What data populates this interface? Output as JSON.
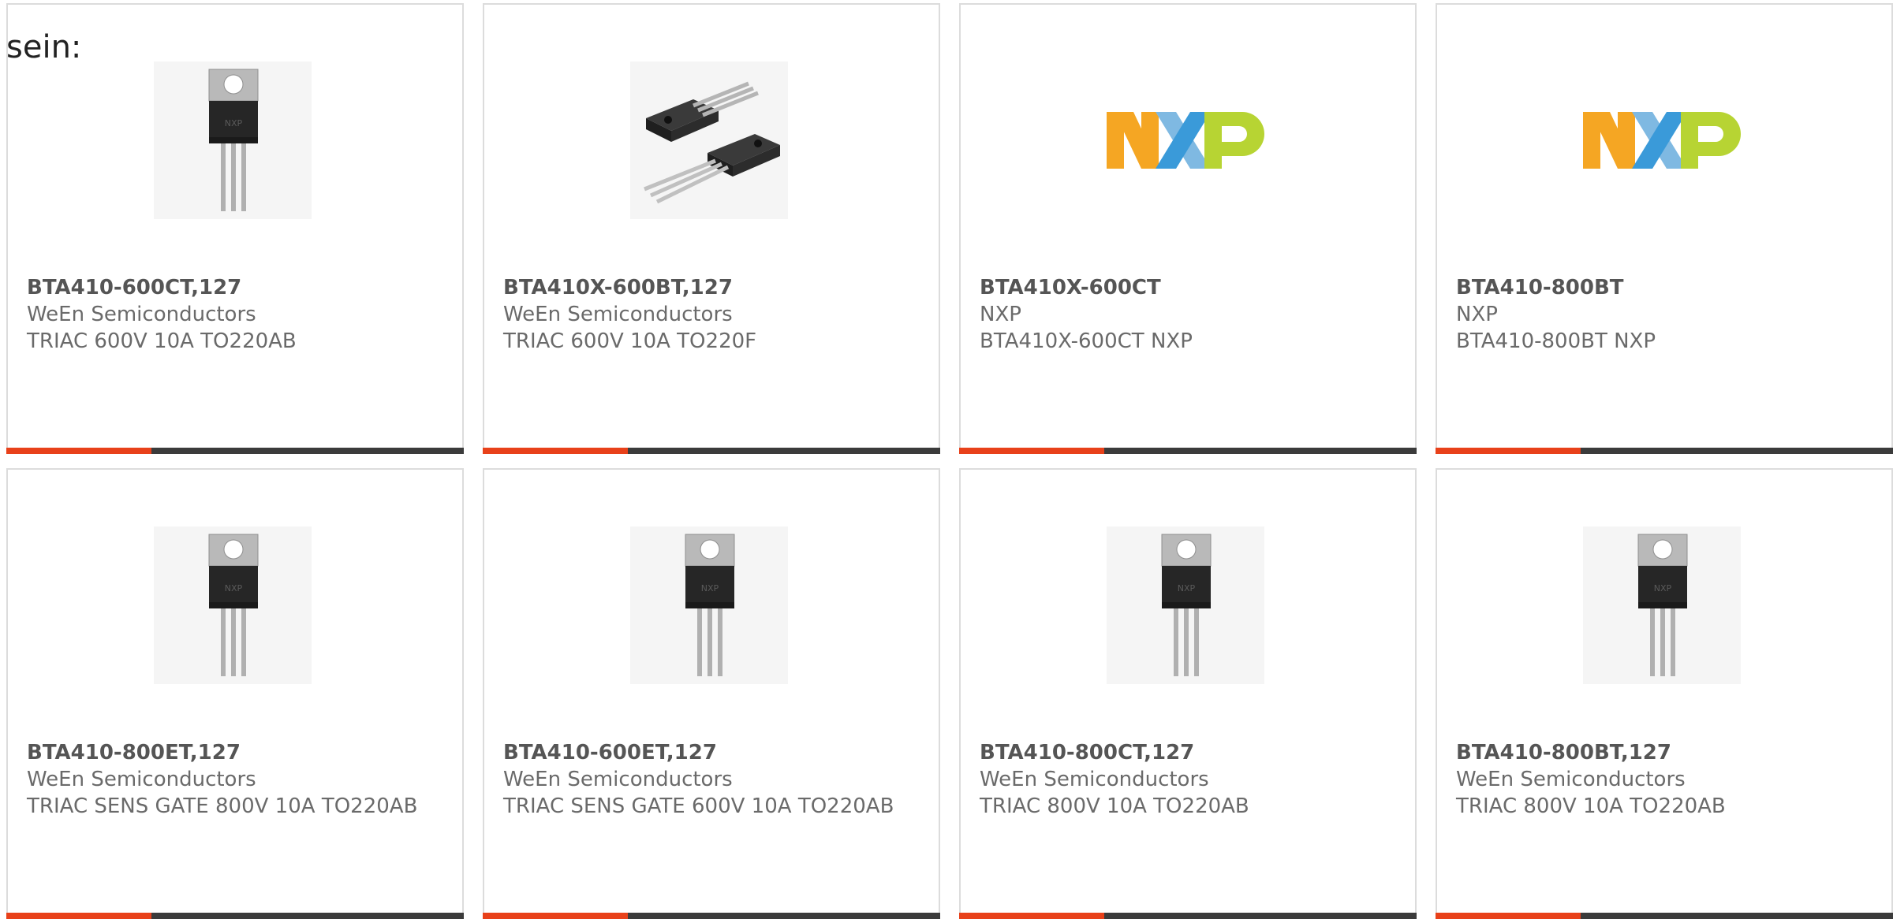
{
  "intro_text": "sein:",
  "accent_color": "#e8411a",
  "bar_color": "#3b3b3b",
  "products": [
    {
      "name": "BTA410-600CT,127",
      "manufacturer": "WeEn Semiconductors",
      "description": "TRIAC 600V 10A TO220AB",
      "image_icon": "to220-triac-icon"
    },
    {
      "name": "BTA410X-600BT,127",
      "manufacturer": "WeEn Semiconductors",
      "description": "TRIAC 600V 10A TO220F",
      "image_icon": "to220f-triac-pair-icon"
    },
    {
      "name": "BTA410X-600CT",
      "manufacturer": "NXP",
      "description": "BTA410X-600CT NXP",
      "image_icon": "nxp-logo-icon"
    },
    {
      "name": "BTA410-800BT",
      "manufacturer": "NXP",
      "description": "BTA410-800BT NXP",
      "image_icon": "nxp-logo-icon"
    },
    {
      "name": "BTA410-800ET,127",
      "manufacturer": "WeEn Semiconductors",
      "description": "TRIAC SENS GATE 800V 10A TO220AB",
      "image_icon": "to220-triac-icon"
    },
    {
      "name": "BTA410-600ET,127",
      "manufacturer": "WeEn Semiconductors",
      "description": "TRIAC SENS GATE 600V 10A TO220AB",
      "image_icon": "to220-triac-icon"
    },
    {
      "name": "BTA410-800CT,127",
      "manufacturer": "WeEn Semiconductors",
      "description": "TRIAC 800V 10A TO220AB",
      "image_icon": "to220-triac-icon"
    },
    {
      "name": "BTA410-800BT,127",
      "manufacturer": "WeEn Semiconductors",
      "description": "TRIAC 800V 10A TO220AB",
      "image_icon": "to220-triac-icon"
    }
  ]
}
